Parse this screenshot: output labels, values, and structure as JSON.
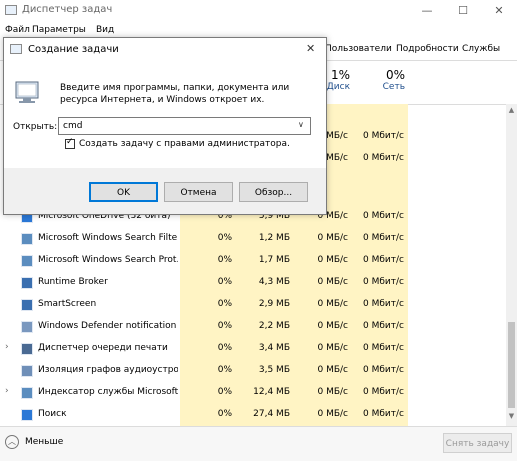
{
  "window": {
    "title": "Диспетчер задач"
  },
  "menu": [
    "Файл",
    "Параметры",
    "Вид"
  ],
  "tabs": {
    "users": "Пользователи",
    "details": "Подробности",
    "services": "Службы"
  },
  "columns": {
    "disk": {
      "pct": "1%",
      "label": "Диск"
    },
    "network": {
      "pct": "0%",
      "label": "Сеть"
    }
  },
  "rows": [
    {
      "name": "Microsoft OneDrive (32 бита)",
      "cpu": "0%",
      "memory": "5,9 МБ",
      "disk": "0 МБ/с",
      "network": "0 Мбит/с",
      "expandable": false
    },
    {
      "name": "Microsoft Windows Search Filte...",
      "cpu": "0%",
      "memory": "1,2 МБ",
      "disk": "0 МБ/с",
      "network": "0 Мбит/с",
      "expandable": false
    },
    {
      "name": "Microsoft Windows Search Prot...",
      "cpu": "0%",
      "memory": "1,7 МБ",
      "disk": "0 МБ/с",
      "network": "0 Мбит/с",
      "expandable": false
    },
    {
      "name": "Runtime Broker",
      "cpu": "0%",
      "memory": "4,3 МБ",
      "disk": "0 МБ/с",
      "network": "0 Мбит/с",
      "expandable": false
    },
    {
      "name": "SmartScreen",
      "cpu": "0%",
      "memory": "2,9 МБ",
      "disk": "0 МБ/с",
      "network": "0 Мбит/с",
      "expandable": false
    },
    {
      "name": "Windows Defender notification ...",
      "cpu": "0%",
      "memory": "2,2 МБ",
      "disk": "0 МБ/с",
      "network": "0 Мбит/с",
      "expandable": false
    },
    {
      "name": "Диспетчер очереди печати",
      "cpu": "0%",
      "memory": "3,4 МБ",
      "disk": "0 МБ/с",
      "network": "0 Мбит/с",
      "expandable": true
    },
    {
      "name": "Изоляция графов аудиоустро...",
      "cpu": "0%",
      "memory": "3,5 МБ",
      "disk": "0 МБ/с",
      "network": "0 Мбит/с",
      "expandable": false
    },
    {
      "name": "Индексатор службы Microsoft...",
      "cpu": "0%",
      "memory": "12,4 МБ",
      "disk": "0 МБ/с",
      "network": "0 Мбит/с",
      "expandable": true
    },
    {
      "name": "Поиск",
      "cpu": "0%",
      "memory": "27,4 МБ",
      "disk": "0 МБ/с",
      "network": "0 Мбит/с",
      "expandable": false
    }
  ],
  "hidden_rows": [
    {
      "disk": "0 МБ/с",
      "network": "0 Мбит/с"
    },
    {
      "disk": "0 МБ/с",
      "network": "0 Мбит/с"
    }
  ],
  "footer": {
    "less_label": "Меньше",
    "end_task_label": "Снять задачу"
  },
  "dialog": {
    "title": "Создание задачи",
    "description": "Введите имя программы, папки, документа или ресурса Интернета, и Windows откроет их.",
    "open_label": "Открыть:",
    "open_value": "cmd",
    "admin_checkbox_label": "Создать задачу с правами администратора.",
    "admin_checked": true,
    "ok_label": "OK",
    "cancel_label": "Отмена",
    "browse_label": "Обзор...",
    "close_glyph": "✕"
  },
  "colors": {
    "highlight": "#fff4c4",
    "accent": "#0078d7",
    "header_text": "#1f4e8c"
  }
}
